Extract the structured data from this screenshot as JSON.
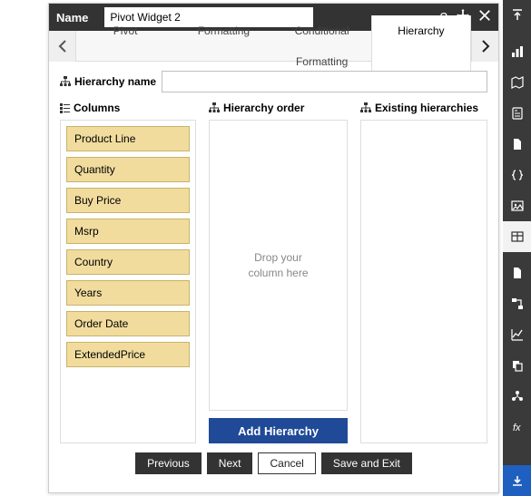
{
  "header": {
    "name_label": "Name",
    "name_value": "Pivot Widget 2"
  },
  "tabs": {
    "items": [
      "Pivot",
      "Formatting",
      "Conditional Formatting",
      "Hierarchy"
    ],
    "active_index": 3
  },
  "hierarchy": {
    "name_label": "Hierarchy name",
    "name_value": "",
    "columns_header": "Columns",
    "order_header": "Hierarchy order",
    "existing_header": "Existing hierarchies",
    "drop_hint": "Drop your\ncolumn here",
    "add_button": "Add Hierarchy",
    "columns": [
      "Product Line",
      "Quantity",
      "Buy Price",
      "Msrp",
      "Country",
      "Years",
      "Order Date",
      "ExtendedPrice"
    ]
  },
  "footer": {
    "previous": "Previous",
    "next": "Next",
    "cancel": "Cancel",
    "save_exit": "Save and Exit"
  },
  "rail_icons": [
    "collapse-up-icon",
    "chart-bar-icon",
    "region-map-icon",
    "script-icon",
    "document-icon",
    "braces-icon",
    "image-icon",
    "table-grid-icon",
    "page-icon",
    "flow-icon",
    "chart-line-icon",
    "copy-icon",
    "cluster-icon",
    "formula-icon"
  ]
}
